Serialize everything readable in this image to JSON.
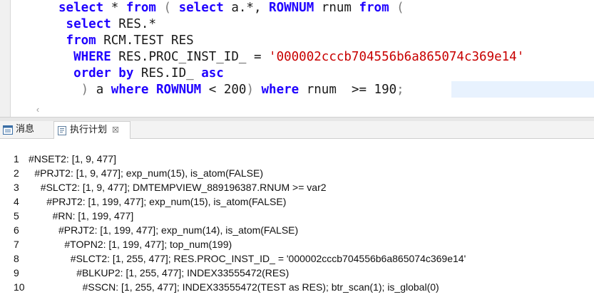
{
  "editor": {
    "lines": [
      [
        {
          "t": "select",
          "c": "kw"
        },
        {
          "t": " * "
        },
        {
          "t": "from",
          "c": "kw"
        },
        {
          "t": " ( ",
          "c": "punct"
        },
        {
          "t": "select",
          "c": "kw"
        },
        {
          "t": " a.*, "
        },
        {
          "t": "ROWNUM",
          "c": "kw"
        },
        {
          "t": " rnum "
        },
        {
          "t": "from",
          "c": "kw"
        },
        {
          "t": " (",
          "c": "punct"
        }
      ],
      [
        {
          "t": " "
        },
        {
          "t": "select",
          "c": "kw"
        },
        {
          "t": " RES.*"
        }
      ],
      [
        {
          "t": " "
        },
        {
          "t": "from",
          "c": "kw"
        },
        {
          "t": " RCM.TEST RES"
        }
      ],
      [
        {
          "t": "  "
        },
        {
          "t": "WHERE",
          "c": "kw"
        },
        {
          "t": " RES.PROC_INST_ID_ = "
        },
        {
          "t": "'000002cccb704556b6a865074c369e14'",
          "c": "str"
        }
      ],
      [
        {
          "t": "  "
        },
        {
          "t": "order by",
          "c": "kw"
        },
        {
          "t": " RES.ID_ "
        },
        {
          "t": "asc",
          "c": "kw"
        }
      ],
      [
        {
          "t": "   ) ",
          "c": "punct"
        },
        {
          "t": "a "
        },
        {
          "t": "where",
          "c": "kw"
        },
        {
          "t": " "
        },
        {
          "t": "ROWNUM",
          "c": "kw"
        },
        {
          "t": " < 200"
        },
        {
          "t": ") ",
          "c": "punct"
        },
        {
          "t": "where",
          "c": "kw"
        },
        {
          "t": " rnum  >= 190"
        },
        {
          "t": ";",
          "c": "punct"
        }
      ]
    ]
  },
  "tabs": {
    "messages_label": "消息",
    "plan_label": "执行计划",
    "close_glyph": "☒"
  },
  "scroll": {
    "left_glyph": "‹"
  },
  "plan": {
    "lines": [
      {
        "num": "1",
        "text": "#NSET2: [1, 9, 477]"
      },
      {
        "num": "2",
        "text": "#PRJT2: [1, 9, 477]; exp_num(15), is_atom(FALSE)"
      },
      {
        "num": "3",
        "text": "#SLCT2: [1, 9, 477]; DMTEMPVIEW_889196387.RNUM >= var2"
      },
      {
        "num": "4",
        "text": "#PRJT2: [1, 199, 477]; exp_num(15), is_atom(FALSE)"
      },
      {
        "num": "5",
        "text": "#RN: [1, 199, 477]"
      },
      {
        "num": "6",
        "text": "#PRJT2: [1, 199, 477]; exp_num(14), is_atom(FALSE)"
      },
      {
        "num": "7",
        "text": "#TOPN2: [1, 199, 477]; top_num(199)"
      },
      {
        "num": "8",
        "text": "#SLCT2: [1, 255, 477]; RES.PROC_INST_ID_ = '000002cccb704556b6a865074c369e14'"
      },
      {
        "num": "9",
        "text": "#BLKUP2: [1, 255, 477]; INDEX33555472(RES)"
      },
      {
        "num": "10",
        "text": "#SSCN: [1, 255, 477]; INDEX33555472(TEST as RES); btr_scan(1); is_global(0)"
      }
    ]
  }
}
